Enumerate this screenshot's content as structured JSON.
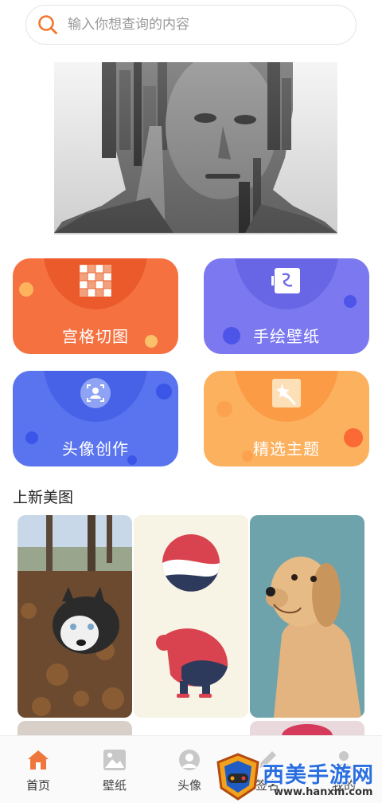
{
  "search": {
    "placeholder": "输入你想查询的内容"
  },
  "features": [
    {
      "label": "宫格切图",
      "icon": "grid-icon",
      "color": "#f57140"
    },
    {
      "label": "手绘壁纸",
      "icon": "drawing-icon",
      "color": "#7b78f0"
    },
    {
      "label": "头像创作",
      "icon": "portrait-icon",
      "color": "#5a74ef"
    },
    {
      "label": "精选主题",
      "icon": "magic-wand-icon",
      "color": "#fcb15f"
    }
  ],
  "section": {
    "title": "上新美图"
  },
  "tabs": [
    {
      "label": "首页",
      "icon": "home-icon",
      "active": true
    },
    {
      "label": "壁纸",
      "icon": "image-icon"
    },
    {
      "label": "头像",
      "icon": "avatar-icon"
    },
    {
      "label": "签名",
      "icon": "pen-icon"
    },
    {
      "label": "我的",
      "icon": "user-icon"
    }
  ],
  "watermark": {
    "text": "西美手游网",
    "url": "www.hanxm.com"
  }
}
